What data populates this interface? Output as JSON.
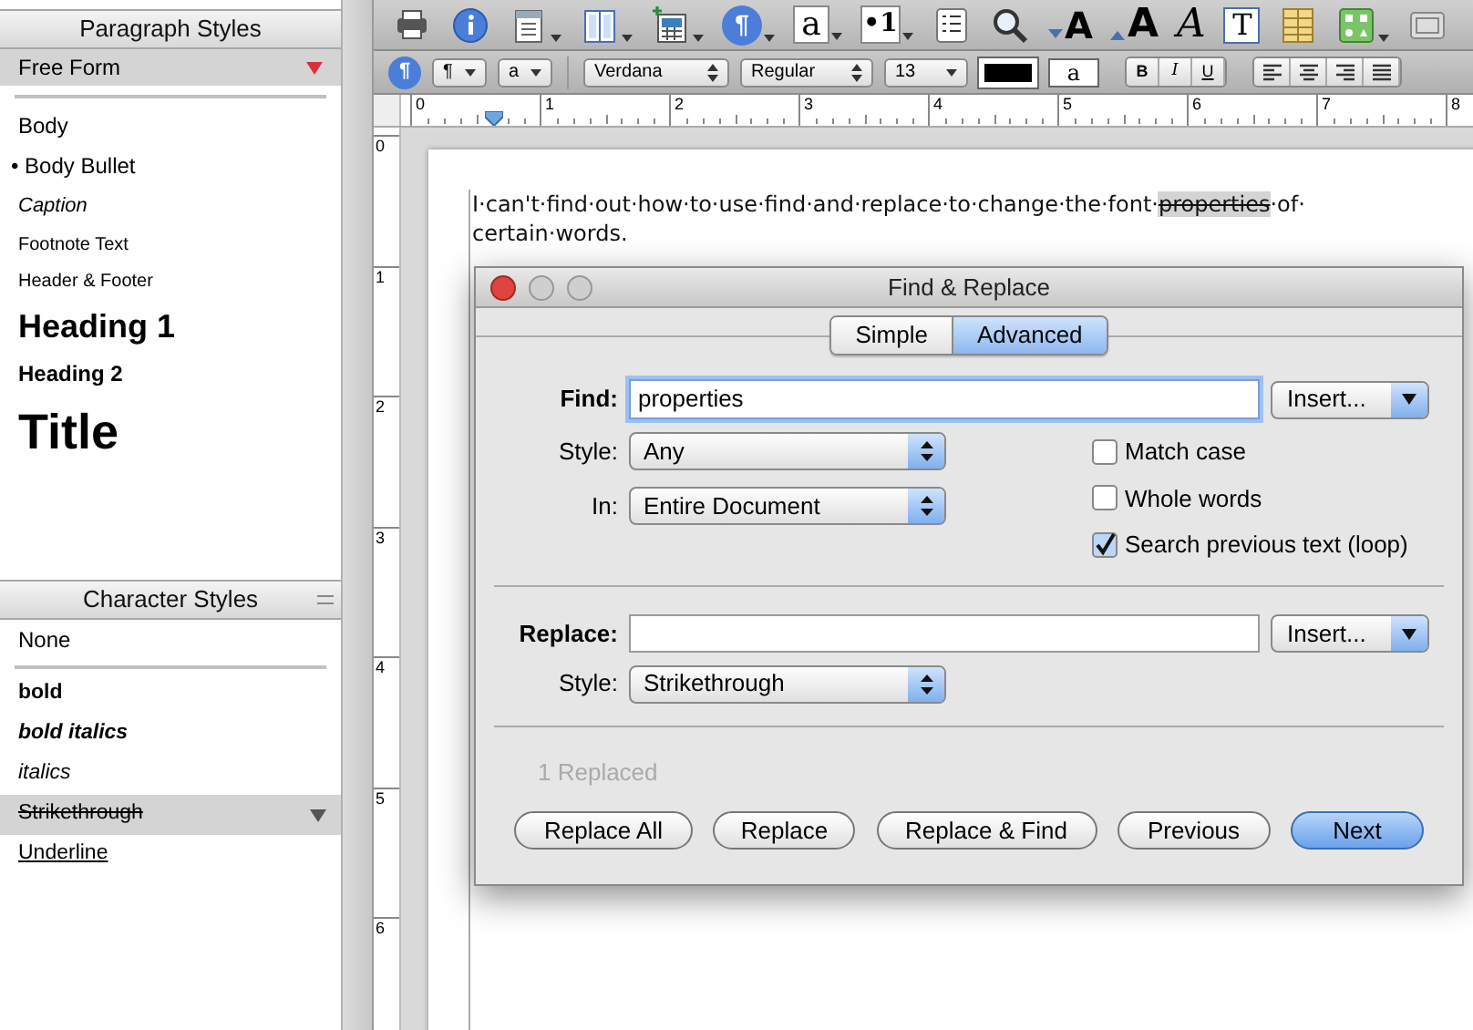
{
  "paragraph_styles": {
    "title": "Paragraph Styles",
    "current": "Free Form",
    "items": [
      {
        "label": "Body",
        "kind": "body",
        "selected": false
      },
      {
        "label": "• Body Bullet",
        "kind": "bullet",
        "selected": false
      },
      {
        "label": "Caption",
        "kind": "caption",
        "selected": false
      },
      {
        "label": "Footnote Text",
        "kind": "small",
        "selected": false
      },
      {
        "label": "Header & Footer",
        "kind": "small",
        "selected": false
      },
      {
        "label": "Heading 1",
        "kind": "heading1",
        "selected": false
      },
      {
        "label": "Heading 2",
        "kind": "heading2",
        "selected": false
      },
      {
        "label": "Title",
        "kind": "title",
        "selected": false
      }
    ]
  },
  "character_styles": {
    "title": "Character Styles",
    "current": "None",
    "items": [
      {
        "label": "bold",
        "kind": "bold",
        "selected": false
      },
      {
        "label": "bold italics",
        "kind": "bolditalic",
        "selected": false
      },
      {
        "label": "italics",
        "kind": "italic",
        "selected": false
      },
      {
        "label": "Strikethrough",
        "kind": "strike",
        "selected": true
      },
      {
        "label": "Underline",
        "kind": "underline",
        "selected": false
      }
    ]
  },
  "toolbar": [
    {
      "kind": "icon",
      "menu": false
    },
    {
      "kind": "icon",
      "menu": false
    },
    {
      "kind": "icon",
      "menu": true
    },
    {
      "kind": "icon",
      "menu": true
    },
    {
      "kind": "icon",
      "menu": true
    },
    {
      "kind": "glyph",
      "glyph": "¶",
      "menu": true
    },
    {
      "kind": "glyph",
      "glyph": "a",
      "menu": true
    },
    {
      "kind": "glyph",
      "glyph": "•1",
      "menu": true
    },
    {
      "kind": "icon",
      "menu": false
    },
    {
      "kind": "icon",
      "menu": false
    },
    {
      "kind": "glyph",
      "glyph": "A",
      "menu": false
    },
    {
      "kind": "glyph",
      "glyph": "A",
      "menu": false
    },
    {
      "kind": "glyph",
      "glyph": "A",
      "menu": false
    },
    {
      "kind": "glyph",
      "glyph": "T",
      "menu": false
    },
    {
      "kind": "icon",
      "menu": false
    },
    {
      "kind": "icon",
      "menu": true
    },
    {
      "kind": "icon",
      "menu": false
    }
  ],
  "format_bar": {
    "paragraph_glyph": "¶",
    "paragraph_popup": "¶",
    "character_popup": "a",
    "font": "Verdana",
    "typeface": "Regular",
    "size": "13",
    "highlight_glyph": "a",
    "bold": "B",
    "italic": "I",
    "underline": "U",
    "alignment": [
      {
        "selected": false
      },
      {
        "selected": false
      },
      {
        "selected": false
      },
      {
        "selected": false
      }
    ]
  },
  "ruler": {
    "marks": [
      "0",
      "1",
      "2",
      "3",
      "4",
      "5",
      "6",
      "7",
      "8"
    ]
  },
  "vertical_ruler": {
    "marks": [
      "0",
      "1",
      "2",
      "3",
      "4",
      "5",
      "6"
    ]
  },
  "document": {
    "lines": [
      {
        "runs": [
          {
            "text": "I·can't·find·out·how·to·use·find·and·replace·to·change·the·font·",
            "kind": "plain"
          },
          {
            "text": "properties",
            "kind": "found"
          },
          {
            "text": "·of·",
            "kind": "plain"
          }
        ]
      },
      {
        "runs": [
          {
            "text": "certain·words.",
            "kind": "plain"
          }
        ]
      }
    ]
  },
  "dialog": {
    "title": "Find & Replace",
    "tabs": [
      {
        "label": "Simple",
        "selected": false
      },
      {
        "label": "Advanced",
        "selected": true
      }
    ],
    "find": {
      "label": "Find:",
      "value": "properties",
      "insert": "Insert..."
    },
    "find_style": {
      "label": "Style:",
      "value": "Any"
    },
    "in": {
      "label": "In:",
      "value": "Entire Document"
    },
    "options": [
      {
        "label": "Match case",
        "checked": false
      },
      {
        "label": "Whole words",
        "checked": false
      },
      {
        "label": "Search previous text (loop)",
        "checked": true
      }
    ],
    "replace": {
      "label": "Replace:",
      "insert": "Insert..."
    },
    "replace_style": {
      "label": "Style:",
      "value": "Strikethrough"
    },
    "status": {
      "text": "1 Replaced",
      "disabled": true
    },
    "buttons": [
      {
        "label": "Replace All",
        "default": false
      },
      {
        "label": "Replace",
        "default": false
      },
      {
        "label": "Replace & Find",
        "default": false
      },
      {
        "label": "Previous",
        "default": false
      },
      {
        "label": "Next",
        "default": true
      }
    ]
  }
}
